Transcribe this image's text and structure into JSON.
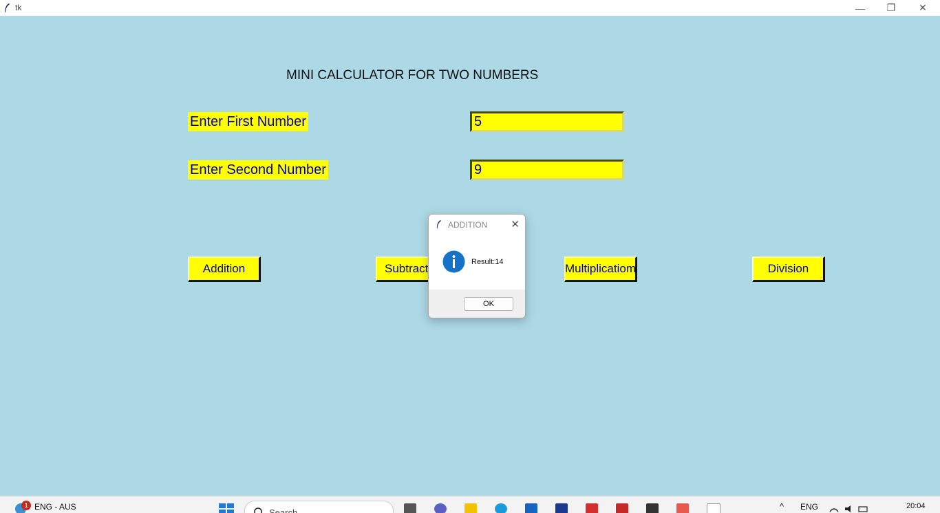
{
  "window": {
    "title": "tk",
    "minimize_glyph": "—",
    "maximize_glyph": "❐",
    "close_glyph": "✕"
  },
  "app": {
    "heading": "MINI CALCULATOR FOR TWO NUMBERS",
    "first_label": "Enter First Number",
    "second_label": "Enter Second Number",
    "first_value": "5",
    "second_value": "9",
    "buttons": {
      "addition": "Addition",
      "subtraction": "Subtraction",
      "multiplication": "Multiplicatiom",
      "division": "Division"
    },
    "colors": {
      "background": "#add8e6",
      "widget_bg": "#ffff00",
      "widget_fg": "#0000b0"
    }
  },
  "dialog": {
    "title": "ADDITION",
    "message": "Result:14",
    "ok_label": "OK",
    "icon": "info-icon",
    "close_glyph": "✕"
  },
  "taskbar": {
    "notification_count": "1",
    "input_language": "ENG - AUS",
    "search_placeholder": "Search",
    "tray_language": "ENG",
    "time": "20:04"
  }
}
